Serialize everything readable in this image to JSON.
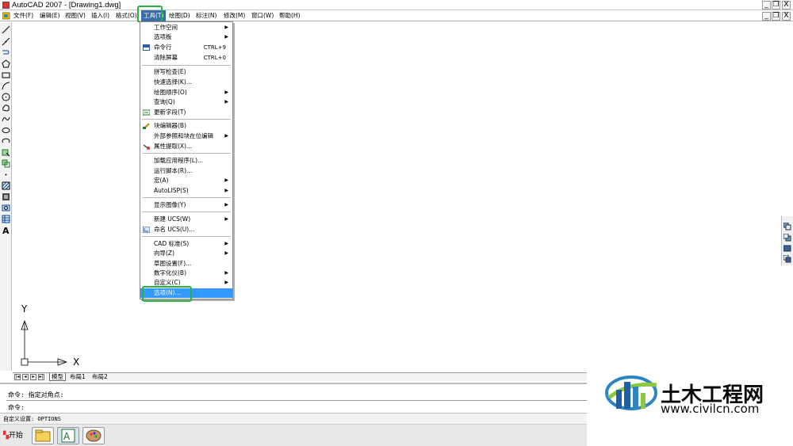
{
  "title_bar": {
    "title": "AutoCAD 2007 - [Drawing1.dwg]",
    "minimize": "_",
    "restore": "❐",
    "close": "X"
  },
  "doc_controls": {
    "minimize": "_",
    "restore": "❐",
    "close": "X"
  },
  "menubar": {
    "items": [
      "文件(F)",
      "编辑(E)",
      "视图(V)",
      "插入(I)",
      "格式(O)",
      "工具(T)",
      "绘图(D)",
      "标注(N)",
      "修改(M)",
      "窗口(W)",
      "帮助(H)"
    ]
  },
  "tools_menu": {
    "items": [
      {
        "label": "工作空间",
        "shortcut": "",
        "submenu": true
      },
      {
        "label": "选项板",
        "shortcut": "",
        "submenu": true
      },
      {
        "label": "命令行",
        "shortcut": "CTRL+9",
        "submenu": false
      },
      {
        "label": "清除屏幕",
        "shortcut": "CTRL+0",
        "submenu": false
      },
      {
        "label": "拼写检查(E)",
        "shortcut": "",
        "submenu": false
      },
      {
        "label": "快速选择(K)...",
        "shortcut": "",
        "submenu": false
      },
      {
        "label": "绘图顺序(O)",
        "shortcut": "",
        "submenu": true
      },
      {
        "label": "查询(Q)",
        "shortcut": "",
        "submenu": true
      },
      {
        "label": "更新字段(T)",
        "shortcut": "",
        "submenu": false
      },
      {
        "label": "块编辑器(B)",
        "shortcut": "",
        "submenu": false
      },
      {
        "label": "外部参照和块在位编辑",
        "shortcut": "",
        "submenu": true
      },
      {
        "label": "属性提取(X)...",
        "shortcut": "",
        "submenu": false
      },
      {
        "label": "加载应用程序(L)...",
        "shortcut": "",
        "submenu": false
      },
      {
        "label": "运行脚本(R)...",
        "shortcut": "",
        "submenu": false
      },
      {
        "label": "宏(A)",
        "shortcut": "",
        "submenu": true
      },
      {
        "label": "AutoLISP(S)",
        "shortcut": "",
        "submenu": true
      },
      {
        "label": "显示图像(Y)",
        "shortcut": "",
        "submenu": true
      },
      {
        "label": "新建 UCS(W)",
        "shortcut": "",
        "submenu": true
      },
      {
        "label": "命名 UCS(U)...",
        "shortcut": "",
        "submenu": false
      },
      {
        "label": "CAD 标准(S)",
        "shortcut": "",
        "submenu": true
      },
      {
        "label": "向导(Z)",
        "shortcut": "",
        "submenu": true
      },
      {
        "label": "草图设置(F)...",
        "shortcut": "",
        "submenu": false
      },
      {
        "label": "数字化仪(B)",
        "shortcut": "",
        "submenu": true
      },
      {
        "label": "自定义(C)",
        "shortcut": "",
        "submenu": true
      },
      {
        "label": "选项(N)...",
        "shortcut": "",
        "submenu": false
      }
    ]
  },
  "ucs": {
    "y_label": "Y",
    "x_label": "X"
  },
  "layout_tabs": {
    "nav": [
      "|◂",
      "◂",
      "▸",
      "▸|"
    ],
    "tabs": [
      "模型",
      "布局1",
      "布局2"
    ]
  },
  "command_window": {
    "line1": "命令: 指定对角点:",
    "line2": "命令:"
  },
  "status": {
    "text": "自定义设置: OPTIONS"
  },
  "taskbar": {
    "start_label": "开始"
  },
  "watermark": {
    "title": "土木工程网",
    "url": "www.civilcn.com"
  },
  "colors": {
    "highlight_green": "#27b043",
    "menu_selection": "#3399ff"
  }
}
